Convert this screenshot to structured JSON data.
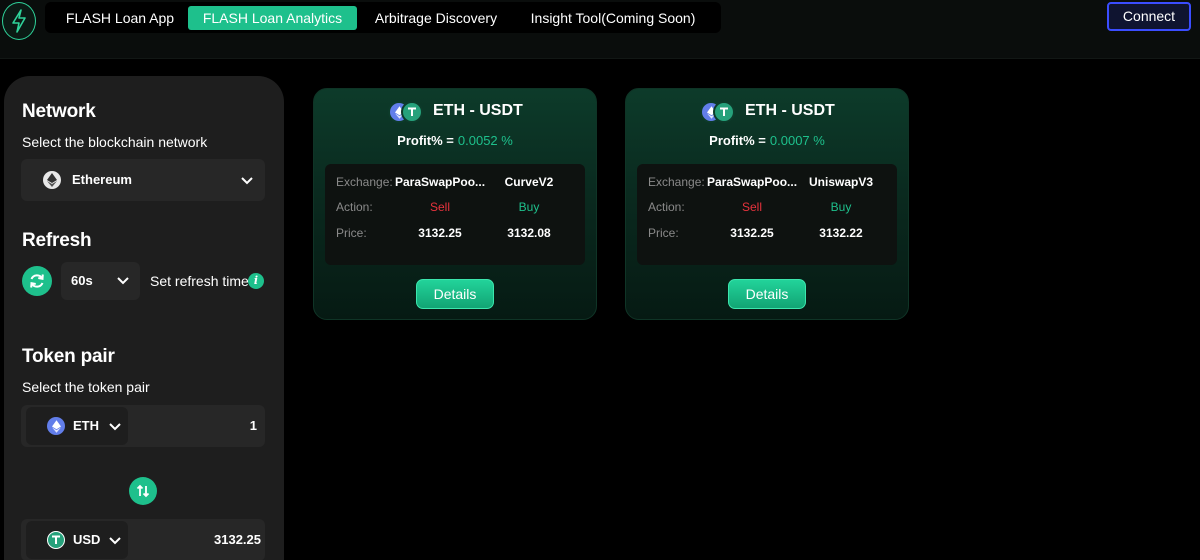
{
  "nav": {
    "tabs": [
      {
        "label": "FLASH Loan App"
      },
      {
        "label": "FLASH Loan Analytics"
      },
      {
        "label": "Arbitrage Discovery"
      },
      {
        "label": "Insight Tool(Coming Soon)"
      }
    ],
    "connect_label": "Connect"
  },
  "sidebar": {
    "network": {
      "heading": "Network",
      "subheading": "Select the blockchain network",
      "selected": "Ethereum"
    },
    "refresh": {
      "heading": "Refresh",
      "interval": "60s",
      "label": "Set refresh time",
      "info": "i"
    },
    "token_pair": {
      "heading": "Token pair",
      "subheading": "Select the token pair",
      "from": {
        "symbol": "ETH",
        "amount": "1"
      },
      "to": {
        "symbol": "USD",
        "amount": "3132.25"
      }
    }
  },
  "labels": {
    "profit": "Profit% =",
    "exchange": "Exchange:",
    "action": "Action:",
    "price": "Price:",
    "details": "Details"
  },
  "cards": [
    {
      "pair": "ETH - USDT",
      "profit": "0.0052 %",
      "sell": {
        "exchange": "ParaSwapPoo...",
        "action": "Sell",
        "price": "3132.25"
      },
      "buy": {
        "exchange": "CurveV2",
        "action": "Buy",
        "price": "3132.08"
      }
    },
    {
      "pair": "ETH - USDT",
      "profit": "0.0007 %",
      "sell": {
        "exchange": "ParaSwapPoo...",
        "action": "Sell",
        "price": "3132.25"
      },
      "buy": {
        "exchange": "UniswapV3",
        "action": "Buy",
        "price": "3132.22"
      }
    }
  ],
  "colors": {
    "accent": "#1ec08c",
    "sell": "#e8333d",
    "connect_border": "#3b4dff",
    "panel": "#1e1e1e"
  },
  "icons": {
    "logo": "lightning-bolt-icon",
    "network": "ethereum-icon",
    "refresh": "refresh-icon",
    "swap": "swap-arrows-icon",
    "tether": "tether-icon"
  }
}
